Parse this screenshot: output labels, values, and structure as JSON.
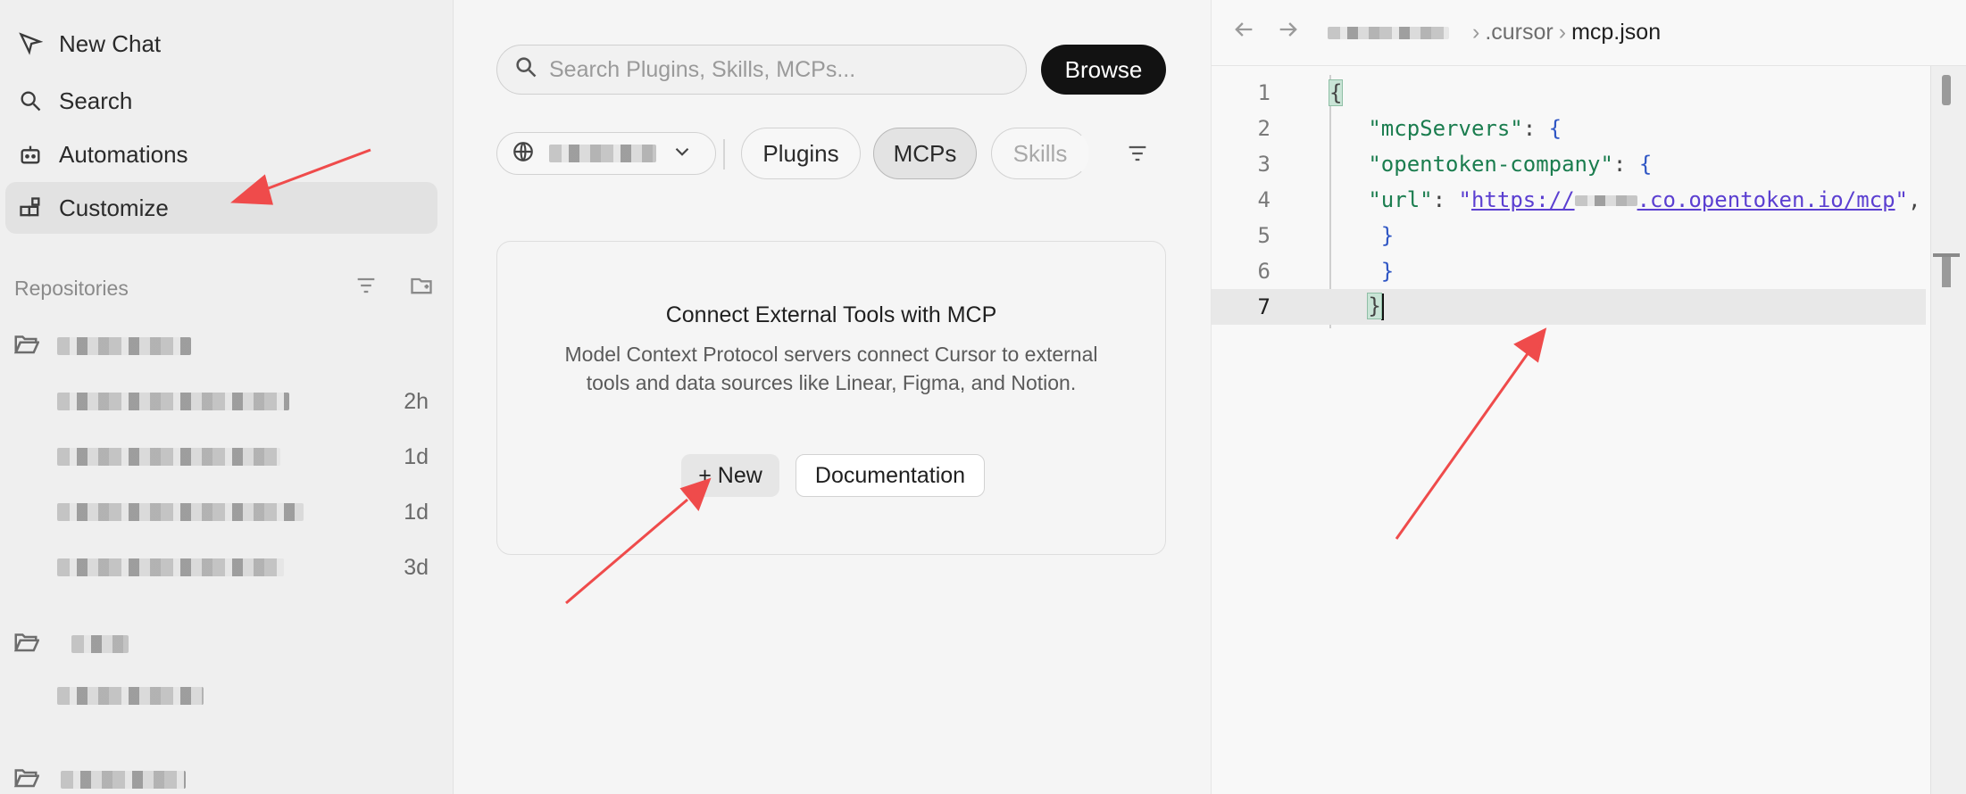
{
  "sidebar": {
    "nav": [
      {
        "label": "New Chat",
        "icon": "send-icon"
      },
      {
        "label": "Search",
        "icon": "search-icon"
      },
      {
        "label": "Automations",
        "icon": "robot-icon"
      },
      {
        "label": "Customize",
        "icon": "blocks-icon",
        "active": true
      }
    ],
    "repositories_label": "Repositories",
    "chats": [
      {
        "age": "2h"
      },
      {
        "age": "1d"
      },
      {
        "age": "1d"
      },
      {
        "age": "3d"
      }
    ]
  },
  "marketplace": {
    "search_placeholder": "Search Plugins, Skills, MCPs...",
    "browse_label": "Browse",
    "tabs": [
      {
        "label": "Plugins",
        "active": false
      },
      {
        "label": "MCPs",
        "active": true
      },
      {
        "label": "Skills",
        "active": false
      }
    ],
    "card": {
      "title": "Connect External Tools with MCP",
      "description": "Model Context Protocol servers connect Cursor to external tools and data sources like Linear, Figma, and Notion.",
      "new_label": "+ New",
      "docs_label": "Documentation"
    }
  },
  "editor": {
    "breadcrumb": [
      ".cursor",
      "mcp.json"
    ],
    "lines": [
      {
        "n": "1"
      },
      {
        "n": "2"
      },
      {
        "n": "3"
      },
      {
        "n": "4"
      },
      {
        "n": "5"
      },
      {
        "n": "6"
      },
      {
        "n": "7"
      }
    ],
    "code": {
      "open": "{",
      "k1": "\"mcpServers\"",
      "k2": "\"opentoken-company\"",
      "k3": "\"url\"",
      "url_prefix": "https://",
      "url_suffix": ".co.opentoken.io/mcp",
      "close": "}"
    }
  },
  "colors": {
    "arrow": "#ef4b4b",
    "key": "#1b7d4f",
    "url": "#5b3fd1",
    "brace": "#2f56c4"
  }
}
